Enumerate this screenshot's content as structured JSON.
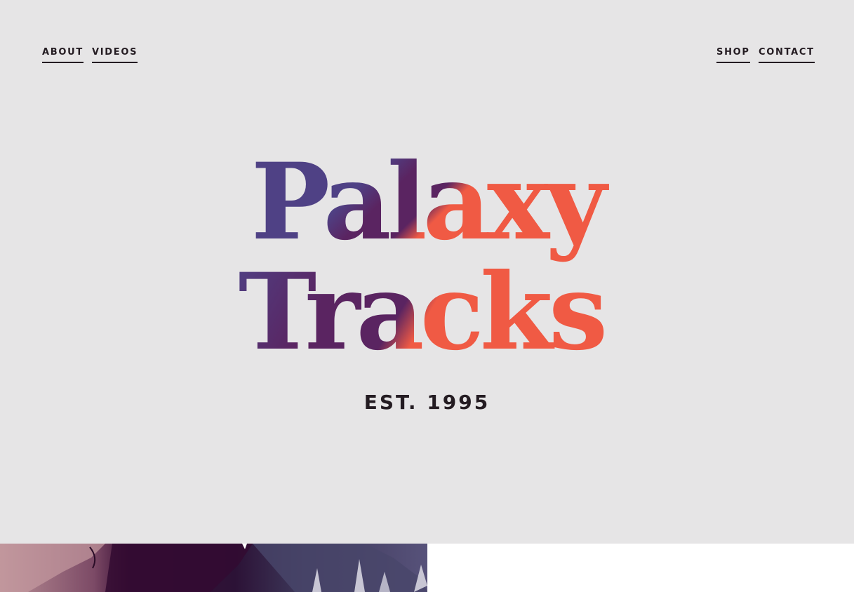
{
  "nav": {
    "left": [
      {
        "label": "ABOUT"
      },
      {
        "label": "VIDEOS"
      }
    ],
    "right": [
      {
        "label": "SHOP"
      },
      {
        "label": "CONTACT"
      }
    ]
  },
  "logo": {
    "line1": "Palaxy",
    "line2": "Tracks"
  },
  "tagline": "EST. 1995",
  "colors": {
    "background": "#e6e5e6",
    "text": "#241c22",
    "logo_purple": "#4f4185",
    "logo_dark_purple": "#5a2461",
    "logo_orange": "#f05a44"
  }
}
